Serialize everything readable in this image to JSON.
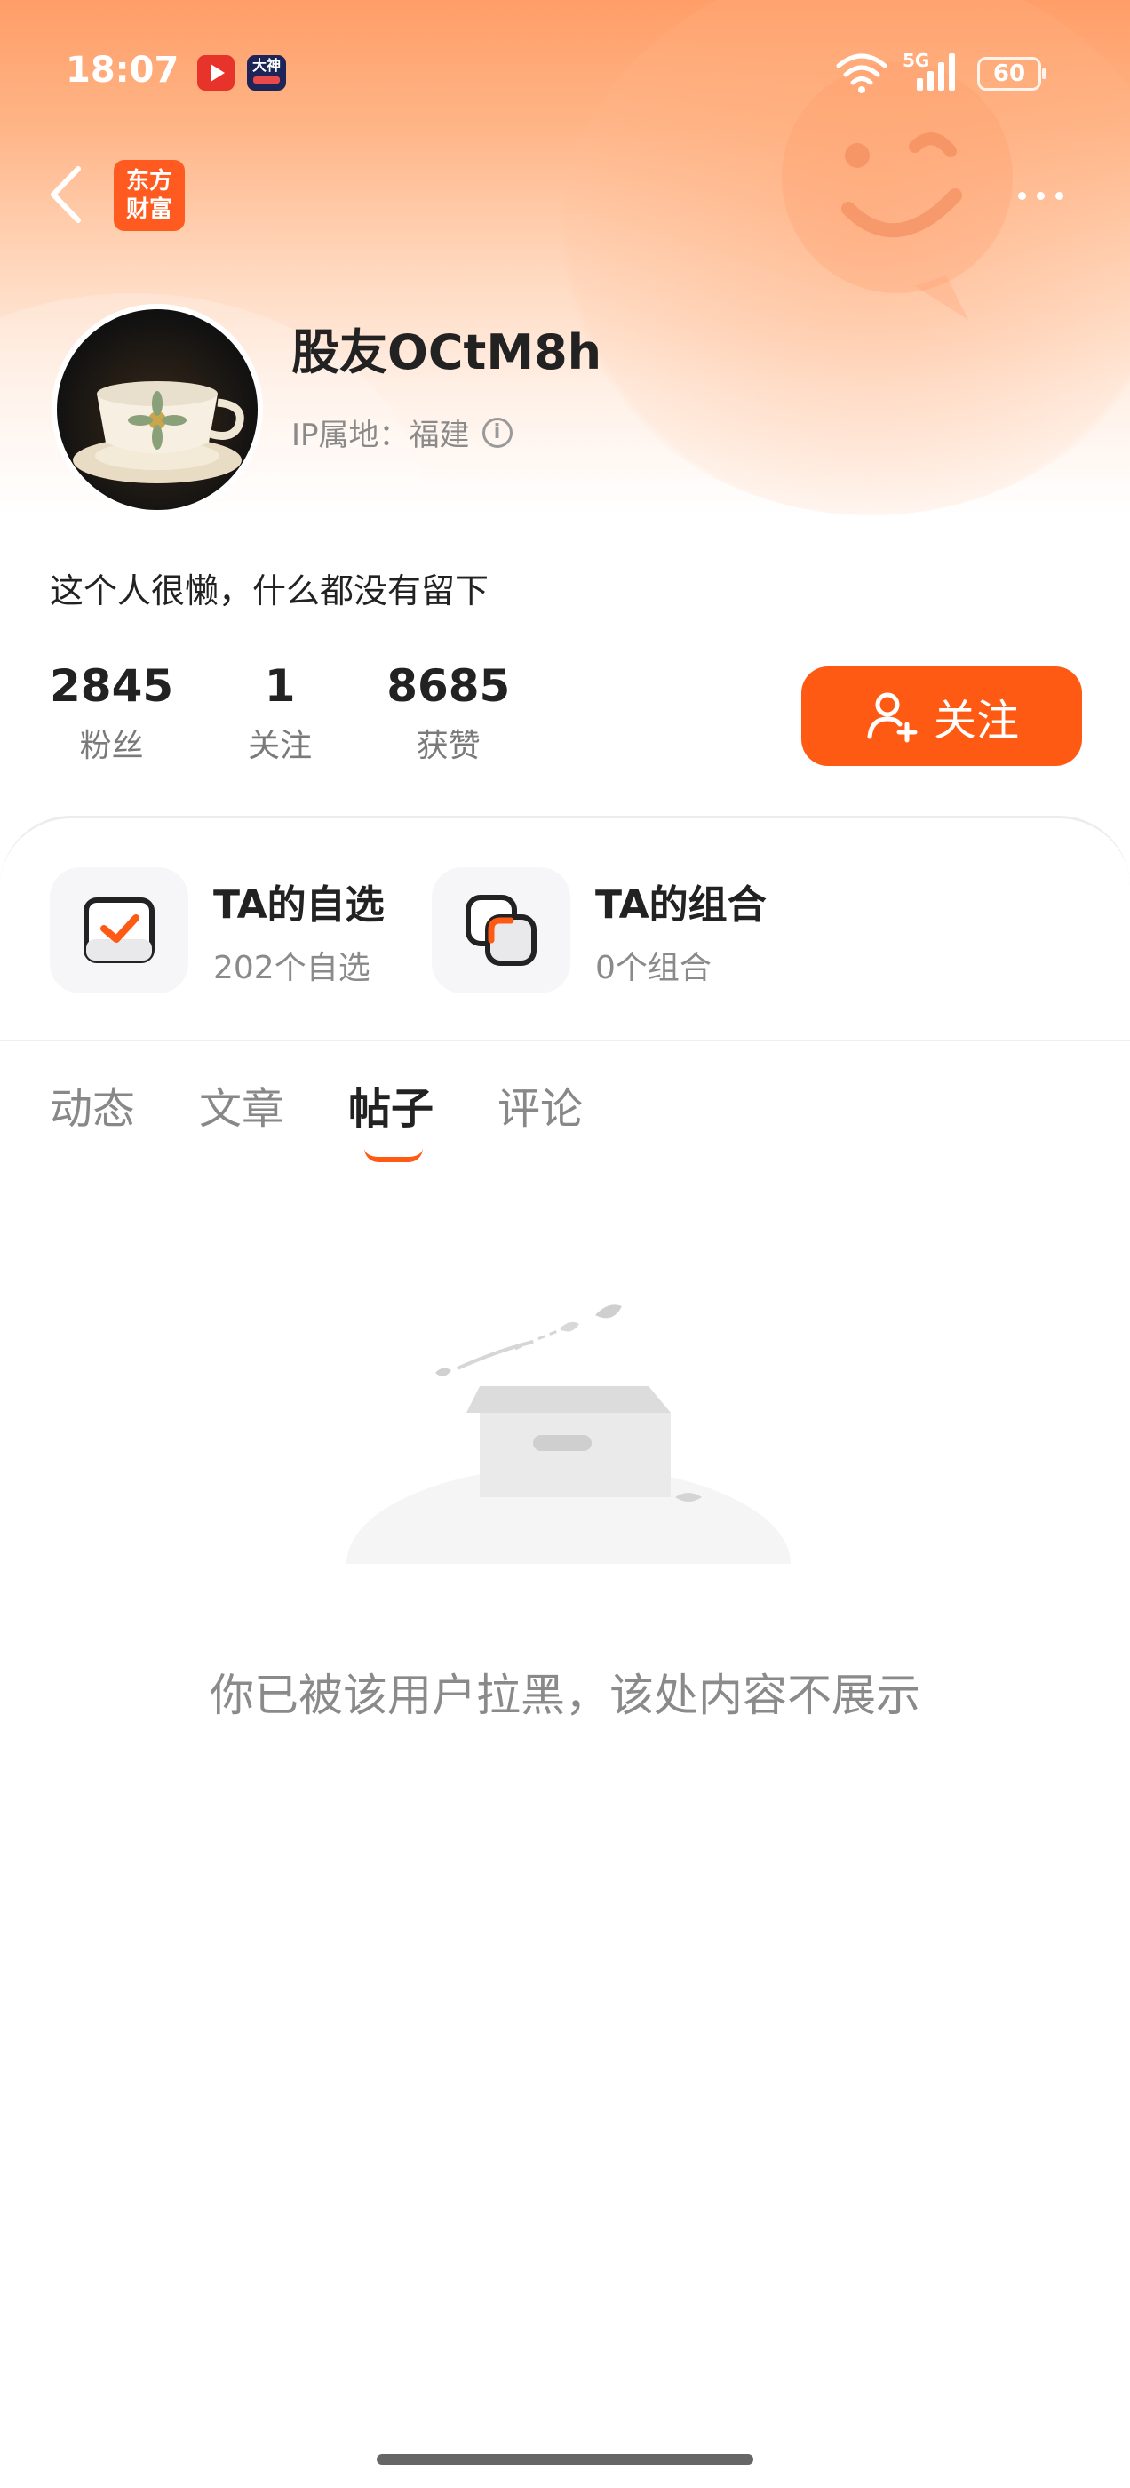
{
  "status_bar": {
    "time": "18:07",
    "app2_label": "大神",
    "network": "5G",
    "battery": "60"
  },
  "nav": {
    "logo_line1": "东方",
    "logo_line2": "财富"
  },
  "profile": {
    "username": "股友OCtM8h",
    "ip_label": "IP属地：福建",
    "bio": "这个人很懒，什么都没有留下",
    "stats": [
      {
        "value": "2845",
        "label": "粉丝"
      },
      {
        "value": "1",
        "label": "关注"
      },
      {
        "value": "8685",
        "label": "获赞"
      }
    ],
    "follow_label": "关注"
  },
  "features": [
    {
      "title": "TA的自选",
      "subtitle": "202个自选"
    },
    {
      "title": "TA的组合",
      "subtitle": "0个组合"
    }
  ],
  "tabs": [
    {
      "label": "动态",
      "active": false
    },
    {
      "label": "文章",
      "active": false
    },
    {
      "label": "帖子",
      "active": true
    },
    {
      "label": "评论",
      "active": false
    }
  ],
  "empty_state": {
    "message": "你已被该用户拉黑，该处内容不展示"
  },
  "colors": {
    "accent": "#ff5a14",
    "header_top": "#ff9e68"
  }
}
